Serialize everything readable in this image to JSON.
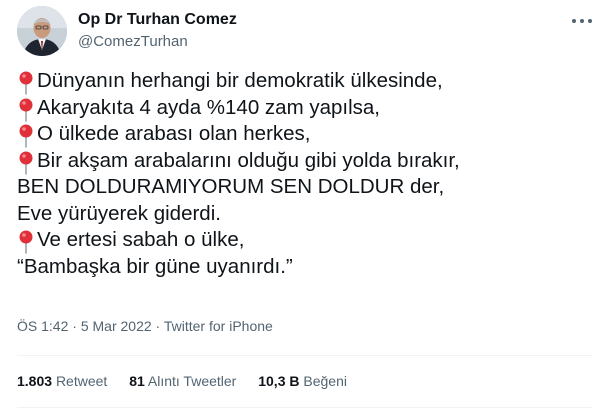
{
  "author": {
    "name": "Op Dr Turhan Comez",
    "handle": "@ComezTurhan"
  },
  "tweet_lines": [
    {
      "text": "Dünyanın herhangi bir demokratik ülkesinde,",
      "pin": true
    },
    {
      "text": "Akaryakıta 4 ayda %140 zam yapılsa,",
      "pin": true
    },
    {
      "text": "O ülkede arabası olan herkes,",
      "pin": true
    },
    {
      "text": "Bir akşam arabalarını olduğu gibi yolda bırakır,",
      "pin": true
    },
    {
      "text": "BEN DOLDURAMIYORUM SEN DOLDUR der,",
      "pin": false
    },
    {
      "text": "Eve yürüyerek giderdi.",
      "pin": false
    },
    {
      "text": "Ve ertesi sabah o ülke,",
      "pin": true
    },
    {
      "text": "“Bambaşka bir güne uyanırdı.”",
      "pin": false
    }
  ],
  "meta": {
    "time": "ÖS 1:42",
    "date": "5 Mar 2022",
    "source": "Twitter for iPhone"
  },
  "stats": {
    "retweets_count": "1.803",
    "retweets_label": "Retweet",
    "quotes_count": "81",
    "quotes_label": "Alıntı Tweetler",
    "likes_count": "10,3 B",
    "likes_label": "Beğeni"
  },
  "icons": {
    "pin": "round-pushpin-icon",
    "more": "more-options-icon"
  },
  "colors": {
    "text": "#0f1419",
    "secondary": "#536471",
    "divider": "#eff3f4",
    "pin": "#e0313b"
  }
}
